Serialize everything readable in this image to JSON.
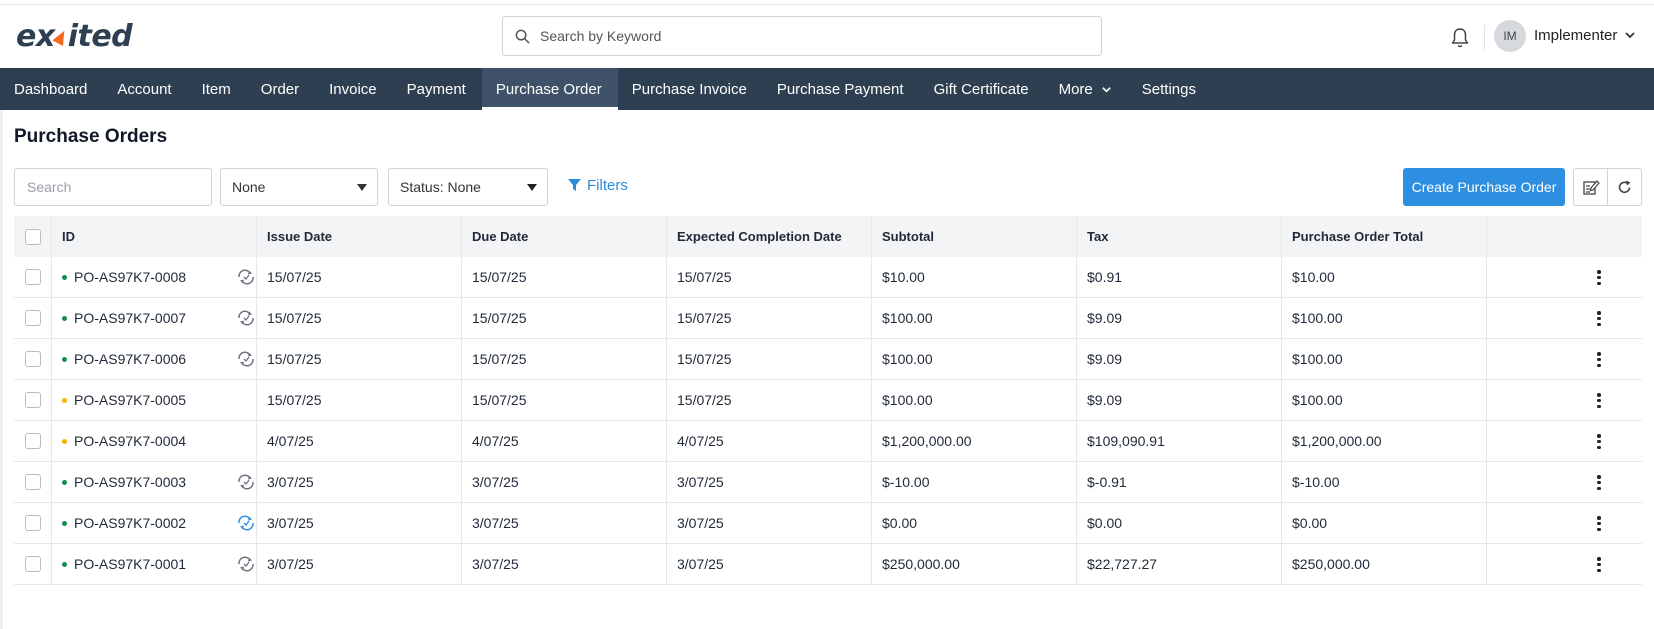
{
  "app": {
    "logo_text_left": "ex",
    "logo_text_right": "ited"
  },
  "header": {
    "search_placeholder": "Search by Keyword",
    "avatar_initials": "IM",
    "username": "Implementer"
  },
  "nav": {
    "items": [
      {
        "label": "Dashboard"
      },
      {
        "label": "Account"
      },
      {
        "label": "Item"
      },
      {
        "label": "Order"
      },
      {
        "label": "Invoice"
      },
      {
        "label": "Payment"
      },
      {
        "label": "Purchase Order",
        "active": true
      },
      {
        "label": "Purchase Invoice"
      },
      {
        "label": "Purchase Payment"
      },
      {
        "label": "Gift Certificate"
      },
      {
        "label": "More",
        "has_dropdown": true
      },
      {
        "label": "Settings"
      }
    ]
  },
  "page": {
    "title": "Purchase Orders",
    "search_placeholder": "Search",
    "select_one": "None",
    "select_status": "Status: None",
    "filters_label": "Filters",
    "create_button": "Create Purchase Order"
  },
  "colors": {
    "nav_bg": "#2f3f52",
    "accent": "#2e8fe0",
    "status_green": "#1a8a4a",
    "status_yellow": "#f4b400",
    "sync_active": "#2e8fe0",
    "sync_inactive": "#6b7280"
  },
  "table": {
    "columns": [
      "ID",
      "Issue Date",
      "Due Date",
      "Expected Completion Date",
      "Subtotal",
      "Tax",
      "Purchase Order Total"
    ],
    "rows": [
      {
        "id": "PO-AS97K7-0008",
        "status": "green",
        "sync": "gray",
        "issue": "15/07/25",
        "due": "15/07/25",
        "expected": "15/07/25",
        "subtotal": "$10.00",
        "tax": "$0.91",
        "total": "$10.00"
      },
      {
        "id": "PO-AS97K7-0007",
        "status": "green",
        "sync": "gray",
        "issue": "15/07/25",
        "due": "15/07/25",
        "expected": "15/07/25",
        "subtotal": "$100.00",
        "tax": "$9.09",
        "total": "$100.00"
      },
      {
        "id": "PO-AS97K7-0006",
        "status": "green",
        "sync": "gray",
        "issue": "15/07/25",
        "due": "15/07/25",
        "expected": "15/07/25",
        "subtotal": "$100.00",
        "tax": "$9.09",
        "total": "$100.00"
      },
      {
        "id": "PO-AS97K7-0005",
        "status": "yellow",
        "sync": "none",
        "issue": "15/07/25",
        "due": "15/07/25",
        "expected": "15/07/25",
        "subtotal": "$100.00",
        "tax": "$9.09",
        "total": "$100.00"
      },
      {
        "id": "PO-AS97K7-0004",
        "status": "yellow",
        "sync": "none",
        "issue": "4/07/25",
        "due": "4/07/25",
        "expected": "4/07/25",
        "subtotal": "$1,200,000.00",
        "tax": "$109,090.91",
        "total": "$1,200,000.00"
      },
      {
        "id": "PO-AS97K7-0003",
        "status": "green",
        "sync": "gray",
        "issue": "3/07/25",
        "due": "3/07/25",
        "expected": "3/07/25",
        "subtotal": "$-10.00",
        "tax": "$-0.91",
        "total": "$-10.00"
      },
      {
        "id": "PO-AS97K7-0002",
        "status": "green",
        "sync": "blue",
        "issue": "3/07/25",
        "due": "3/07/25",
        "expected": "3/07/25",
        "subtotal": "$0.00",
        "tax": "$0.00",
        "total": "$0.00"
      },
      {
        "id": "PO-AS97K7-0001",
        "status": "green",
        "sync": "gray",
        "issue": "3/07/25",
        "due": "3/07/25",
        "expected": "3/07/25",
        "subtotal": "$250,000.00",
        "tax": "$22,727.27",
        "total": "$250,000.00"
      }
    ]
  }
}
